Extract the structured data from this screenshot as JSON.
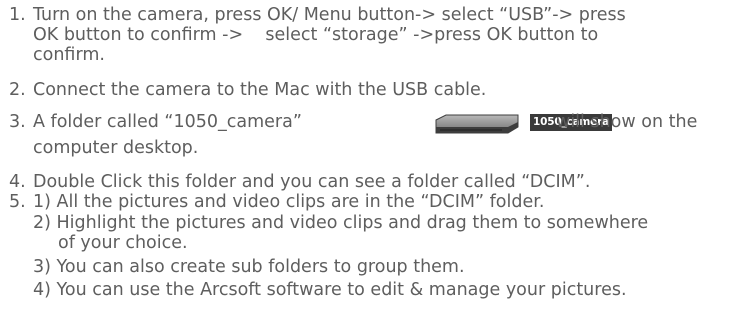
{
  "items": [
    {
      "number": "1.",
      "lines": [
        "Turn on the camera, press OK/ Menu button-> select “USB”-> press",
        "OK button to confirm ->    select “storage” ->press OK button to",
        "confirm."
      ]
    },
    {
      "number": "2.",
      "lines": [
        "Connect the camera to the Mac with the USB cable."
      ]
    },
    {
      "number": "3.",
      "line_before_icon": "A folder called “1050_camera”",
      "icon_label": "1050_camera",
      "line_after_icon": "will show on the",
      "line_continued": "computer desktop."
    },
    {
      "number": "4.",
      "lines": [
        "Double Click this folder and you can see a folder called “DCIM”."
      ]
    },
    {
      "number": "5.",
      "subitems": [
        {
          "lines": [
            "1) All the pictures and video clips are in the “DCIM” folder."
          ]
        },
        {
          "lines": [
            "2) Highlight the pictures and video clips and drag them to somewhere",
            "of your choice."
          ]
        },
        {
          "lines": [
            "3) You can also create sub folders to group them."
          ]
        },
        {
          "lines": [
            "4) You can use the Arcsoft software to edit & manage your pictures."
          ]
        }
      ]
    }
  ]
}
